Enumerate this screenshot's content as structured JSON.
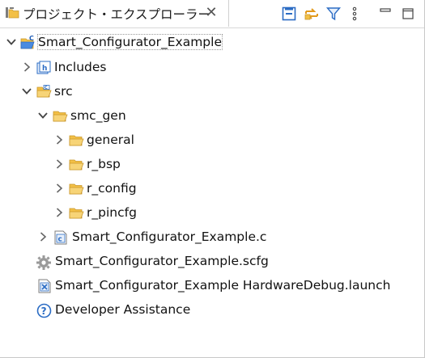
{
  "view": {
    "title": "プロジェクト・エクスプローラー",
    "close_glyph": "✕"
  },
  "toolbar": {
    "buttons": [
      "collapse-all-icon",
      "link-with-editor-icon",
      "filter-icon",
      "view-menu-icon",
      "minimize-icon",
      "maximize-icon"
    ]
  },
  "tree": {
    "project": "Smart_Configurator_Example",
    "includes": "Includes",
    "src": "src",
    "smc_gen": "smc_gen",
    "general": "general",
    "r_bsp": "r_bsp",
    "r_config": "r_config",
    "r_pincfg": "r_pincfg",
    "c_file": "Smart_Configurator_Example.c",
    "scfg_file": "Smart_Configurator_Example.scfg",
    "launch_file": "Smart_Configurator_Example HardwareDebug.launch",
    "assistance": "Developer Assistance"
  },
  "colors": {
    "folder": "#f3c046",
    "folder_dark": "#c9962a",
    "accent_blue": "#2b6cc4",
    "twistie": "#555555"
  }
}
